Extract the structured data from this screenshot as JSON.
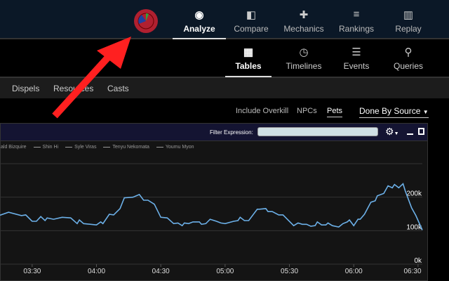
{
  "header": {
    "nav": [
      {
        "label": "Analyze",
        "icon": "eye-icon",
        "active": true
      },
      {
        "label": "Compare",
        "icon": "compare-icon"
      },
      {
        "label": "Mechanics",
        "icon": "puzzle-icon"
      },
      {
        "label": "Rankings",
        "icon": "rankings-icon"
      },
      {
        "label": "Replay",
        "icon": "film-icon"
      }
    ]
  },
  "subnav": [
    {
      "label": "Tables",
      "icon": "grid-icon",
      "active": true
    },
    {
      "label": "Timelines",
      "icon": "clock-icon"
    },
    {
      "label": "Events",
      "icon": "list-icon"
    },
    {
      "label": "Queries",
      "icon": "map-pin-icon"
    }
  ],
  "tabs": [
    "Dispels",
    "Resources",
    "Casts"
  ],
  "options": {
    "overkill": "Include Overkill",
    "npcs": "NPCs",
    "pets": "Pets",
    "source": "Done By Source"
  },
  "panel": {
    "filter_label": "Filter Expression:",
    "filter_value": "",
    "legend": [
      "ald Bizquire",
      "Shin Hi",
      "Syle Viras",
      "Tenyu Nekomata",
      "Youmu Myon"
    ]
  },
  "colors": {
    "line": "#6cb0e8",
    "arrow": "#ff2020",
    "logo": "#b02030"
  },
  "chart_data": {
    "type": "line",
    "xlim": [
      "3:15",
      "6:32"
    ],
    "ylim": [
      0,
      300000
    ],
    "grid": true,
    "x_ticks": [
      "03:30",
      "04:00",
      "04:30",
      "05:00",
      "05:30",
      "06:00",
      "06:30"
    ],
    "y_ticks": [
      "0k",
      "100k",
      "200k"
    ],
    "x": [
      "3:15",
      "3:19",
      "3:25",
      "3:27",
      "3:30",
      "3:32",
      "3:34",
      "3:36",
      "3:37",
      "3:40",
      "3:44",
      "3:48",
      "3:51",
      "3:52",
      "3:54",
      "4:00",
      "4:02",
      "4:03",
      "4:06",
      "4:08",
      "4:11",
      "4:13",
      "4:17",
      "4:20",
      "4:22",
      "4:24",
      "4:27",
      "4:30",
      "4:33",
      "4:36",
      "4:38",
      "4:40",
      "4:41",
      "4:43",
      "4:45",
      "4:48",
      "4:49",
      "4:51",
      "4:53",
      "4:56",
      "4:58",
      "5:00",
      "5:04",
      "5:06",
      "5:07",
      "5:09",
      "5:11",
      "5:15",
      "5:16",
      "5:19",
      "5:20",
      "5:22",
      "5:25",
      "5:27",
      "5:29",
      "5:32",
      "5:34",
      "5:36",
      "5:38",
      "5:40",
      "5:42",
      "5:43",
      "5:45",
      "5:47",
      "5:48",
      "5:50",
      "5:53",
      "5:55",
      "5:57",
      "5:58",
      "6:00",
      "6:02",
      "6:03",
      "6:05",
      "6:08",
      "6:10",
      "6:11",
      "6:14",
      "6:16",
      "6:18",
      "6:19",
      "6:21",
      "6:23",
      "6:24",
      "6:27",
      "6:29",
      "6:32"
    ],
    "values": [
      146000,
      155000,
      145000,
      147000,
      128000,
      128000,
      142000,
      130000,
      138000,
      134000,
      140000,
      138000,
      121000,
      132000,
      121000,
      117000,
      126000,
      121000,
      149000,
      147000,
      166000,
      198000,
      200000,
      208000,
      191000,
      191000,
      179000,
      140000,
      138000,
      121000,
      123000,
      115000,
      123000,
      121000,
      126000,
      126000,
      119000,
      121000,
      134000,
      128000,
      123000,
      121000,
      128000,
      130000,
      140000,
      130000,
      130000,
      164000,
      164000,
      166000,
      157000,
      157000,
      147000,
      147000,
      134000,
      115000,
      123000,
      119000,
      119000,
      113000,
      115000,
      126000,
      117000,
      117000,
      123000,
      115000,
      111000,
      121000,
      126000,
      132000,
      115000,
      134000,
      134000,
      149000,
      185000,
      189000,
      204000,
      211000,
      234000,
      228000,
      238000,
      228000,
      240000,
      219000,
      168000,
      145000,
      102000
    ]
  }
}
